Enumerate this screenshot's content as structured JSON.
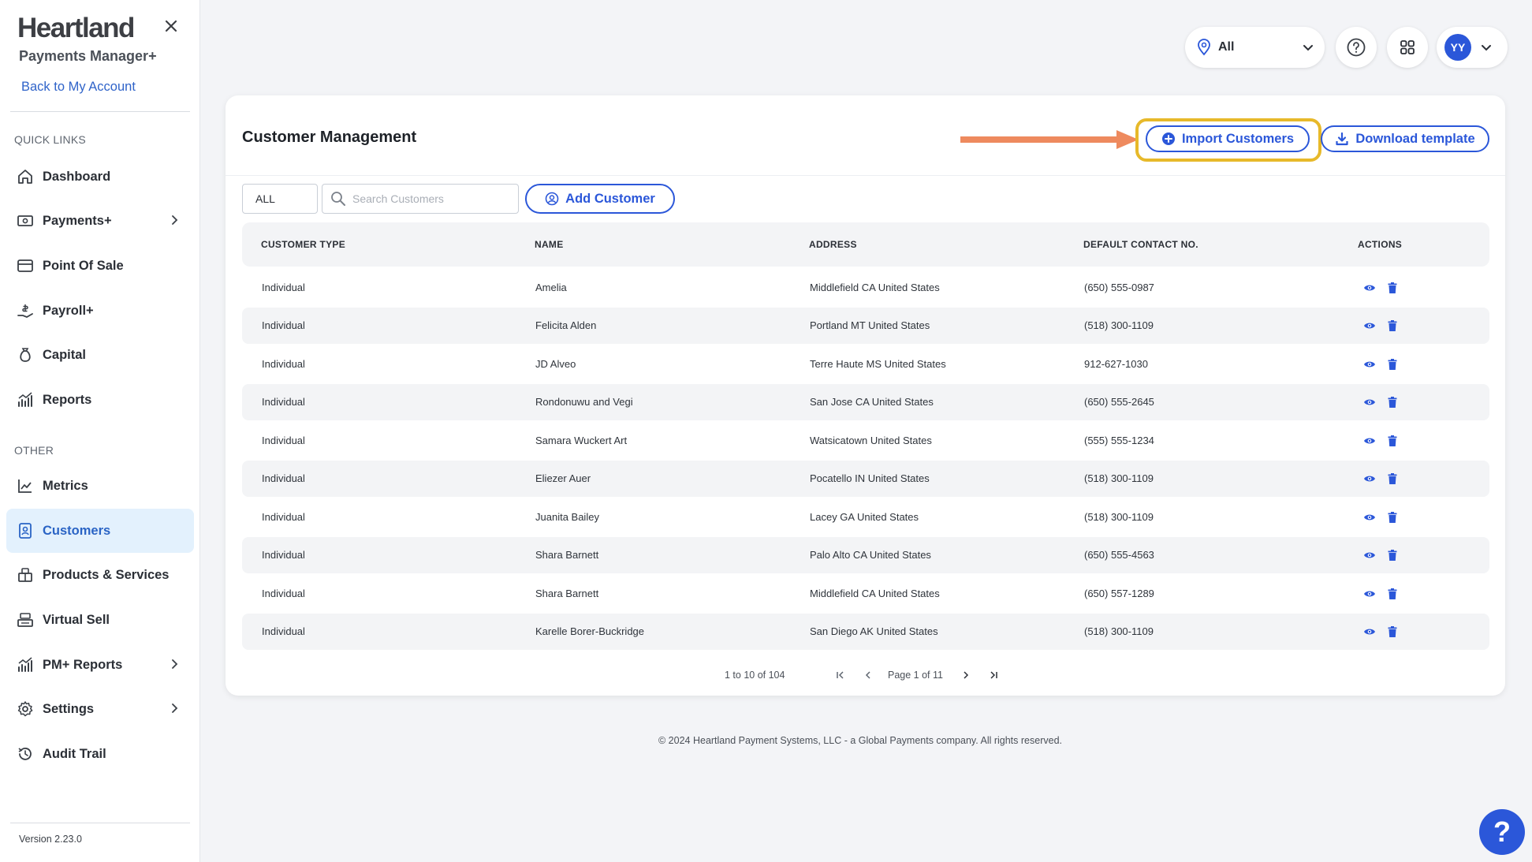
{
  "sidebar": {
    "brand": "Heartland",
    "product": "Payments Manager+",
    "back_link": "Back to My Account",
    "quick_links_label": "QUICK LINKS",
    "other_label": "OTHER",
    "quick_links": [
      {
        "label": "Dashboard",
        "icon": "home-icon"
      },
      {
        "label": "Payments+",
        "icon": "payments-icon",
        "has_submenu": true
      },
      {
        "label": "Point Of Sale",
        "icon": "card-icon"
      },
      {
        "label": "Payroll+",
        "icon": "payroll-icon"
      },
      {
        "label": "Capital",
        "icon": "money-bag-icon"
      },
      {
        "label": "Reports",
        "icon": "reports-icon"
      }
    ],
    "other": [
      {
        "label": "Metrics",
        "icon": "metrics-icon"
      },
      {
        "label": "Customers",
        "icon": "customers-icon",
        "active": true
      },
      {
        "label": "Products & Services",
        "icon": "products-icon"
      },
      {
        "label": "Virtual Sell",
        "icon": "register-icon"
      },
      {
        "label": "PM+ Reports",
        "icon": "reports-icon",
        "has_submenu": true
      },
      {
        "label": "Settings",
        "icon": "gear-icon",
        "has_submenu": true
      },
      {
        "label": "Audit Trail",
        "icon": "history-icon"
      }
    ],
    "version": "Version 2.23.0"
  },
  "topbar": {
    "location_value": "All",
    "user_initials": "YY"
  },
  "card": {
    "title": "Customer Management",
    "import_label": "Import Customers",
    "download_label": "Download template",
    "filter_value": "ALL",
    "search_placeholder": "Search Customers",
    "add_label": "Add Customer"
  },
  "table": {
    "columns": [
      "CUSTOMER TYPE",
      "NAME",
      "ADDRESS",
      "DEFAULT CONTACT NO.",
      "ACTIONS"
    ],
    "rows": [
      [
        "Individual",
        "Amelia",
        "Middlefield CA United States",
        "(650) 555-0987"
      ],
      [
        "Individual",
        "Felicita Alden",
        "Portland MT United States",
        "(518) 300-1109"
      ],
      [
        "Individual",
        "JD Alveo",
        "Terre Haute MS United States",
        "912-627-1030"
      ],
      [
        "Individual",
        "Rondonuwu and Vegi",
        "San Jose CA United States",
        "(650) 555-2645"
      ],
      [
        "Individual",
        "Samara Wuckert Art",
        "Watsicatown United States",
        "(555) 555-1234"
      ],
      [
        "Individual",
        "Eliezer Auer",
        "Pocatello IN United States",
        "(518) 300-1109"
      ],
      [
        "Individual",
        "Juanita Bailey",
        "Lacey GA United States",
        "(518) 300-1109"
      ],
      [
        "Individual",
        "Shara Barnett",
        "Palo Alto CA United States",
        "(650) 555-4563"
      ],
      [
        "Individual",
        "Shara Barnett",
        "Middlefield CA United States",
        "(650) 557-1289"
      ],
      [
        "Individual",
        "Karelle Borer-Buckridge",
        "San Diego AK United States",
        "(518) 300-1109"
      ]
    ]
  },
  "pagination": {
    "range": "1 to 10 of 104",
    "page": "Page 1 of 11"
  },
  "footer": "© 2024 Heartland Payment Systems, LLC - a Global Payments company. All rights reserved.",
  "help_fab": "?",
  "colors": {
    "accent": "#2b57d9",
    "highlight": "#e7b92a",
    "arrow": "#ee8a5e",
    "active_bg": "#e3f1fd"
  }
}
